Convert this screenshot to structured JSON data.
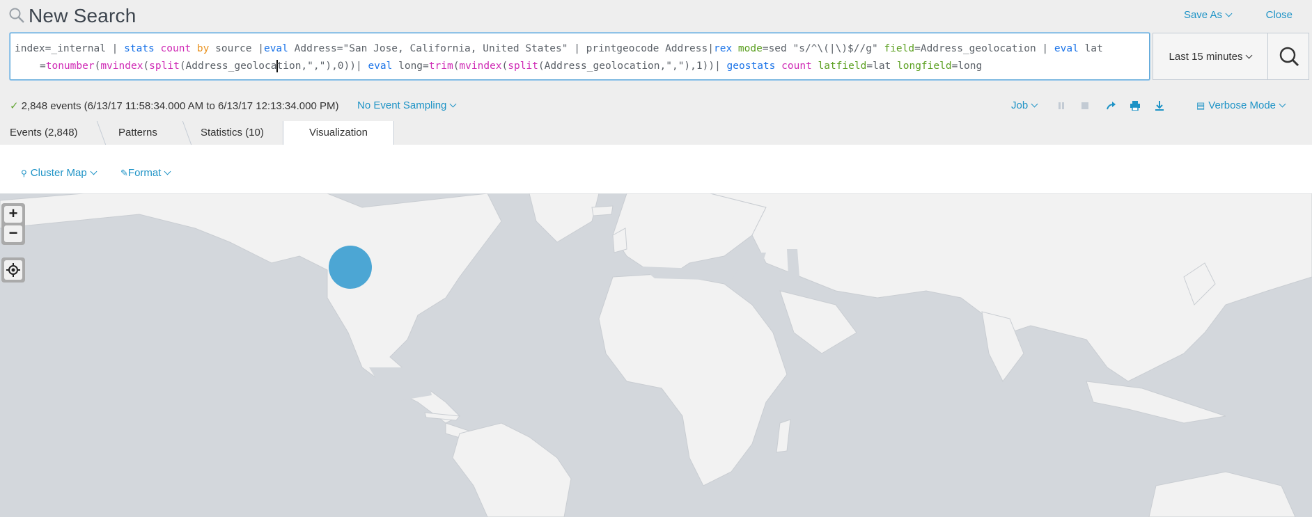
{
  "header": {
    "title": "New Search",
    "save_as": "Save As",
    "close": "Close"
  },
  "search": {
    "line1": [
      {
        "t": "index=_internal | ",
        "c": ""
      },
      {
        "t": "stats",
        "c": "k-blue"
      },
      {
        "t": " ",
        "c": ""
      },
      {
        "t": "count",
        "c": "k-pink"
      },
      {
        "t": " ",
        "c": ""
      },
      {
        "t": "by",
        "c": "k-orange"
      },
      {
        "t": " source |",
        "c": ""
      },
      {
        "t": "eval",
        "c": "k-blue"
      },
      {
        "t": " Address=\"San Jose, California, United States\" | printgeocode Address|",
        "c": ""
      },
      {
        "t": "rex",
        "c": "k-blue"
      },
      {
        "t": " ",
        "c": ""
      },
      {
        "t": "mode",
        "c": "k-green"
      },
      {
        "t": "=sed \"s/^\\(|\\)$//g\" ",
        "c": ""
      },
      {
        "t": "field",
        "c": "k-green"
      },
      {
        "t": "=Address_geolocation | ",
        "c": ""
      },
      {
        "t": "eval",
        "c": "k-blue"
      },
      {
        "t": " lat",
        "c": ""
      }
    ],
    "line2": [
      {
        "t": "=",
        "c": ""
      },
      {
        "t": "tonumber",
        "c": "k-pink"
      },
      {
        "t": "(",
        "c": ""
      },
      {
        "t": "mvindex",
        "c": "k-pink"
      },
      {
        "t": "(",
        "c": ""
      },
      {
        "t": "split",
        "c": "k-pink"
      },
      {
        "t": "(Address_geoloca",
        "c": ""
      },
      {
        "t": "",
        "c": "cursor"
      },
      {
        "t": "tion,\",\"),0))| ",
        "c": ""
      },
      {
        "t": "eval",
        "c": "k-blue"
      },
      {
        "t": " long=",
        "c": ""
      },
      {
        "t": "trim",
        "c": "k-pink"
      },
      {
        "t": "(",
        "c": ""
      },
      {
        "t": "mvindex",
        "c": "k-pink"
      },
      {
        "t": "(",
        "c": ""
      },
      {
        "t": "split",
        "c": "k-pink"
      },
      {
        "t": "(Address_geolocation,\",\"),1))| ",
        "c": ""
      },
      {
        "t": "geostats",
        "c": "k-blue"
      },
      {
        "t": " ",
        "c": ""
      },
      {
        "t": "count",
        "c": "k-pink"
      },
      {
        "t": " ",
        "c": ""
      },
      {
        "t": "latfield",
        "c": "k-green"
      },
      {
        "t": "=lat ",
        "c": ""
      },
      {
        "t": "longfield",
        "c": "k-green"
      },
      {
        "t": "=long",
        "c": ""
      }
    ],
    "time_range": "Last 15 minutes"
  },
  "status": {
    "events": "2,848 events (6/13/17 11:58:34.000 AM to 6/13/17 12:13:34.000 PM)",
    "sampling": "No Event Sampling",
    "job": "Job",
    "mode": "Verbose Mode"
  },
  "tabs": {
    "events": "Events (2,848)",
    "patterns": "Patterns",
    "statistics": "Statistics (10)",
    "visualization": "Visualization"
  },
  "viz": {
    "type": "Cluster Map",
    "format": "Format"
  },
  "colors": {
    "link": "#1e93c6",
    "map_water": "#d3d7dc",
    "map_land": "#f2f2f2",
    "cluster": "#3e9fd1"
  },
  "map": {
    "cluster_location": "San Jose, California, United States"
  }
}
